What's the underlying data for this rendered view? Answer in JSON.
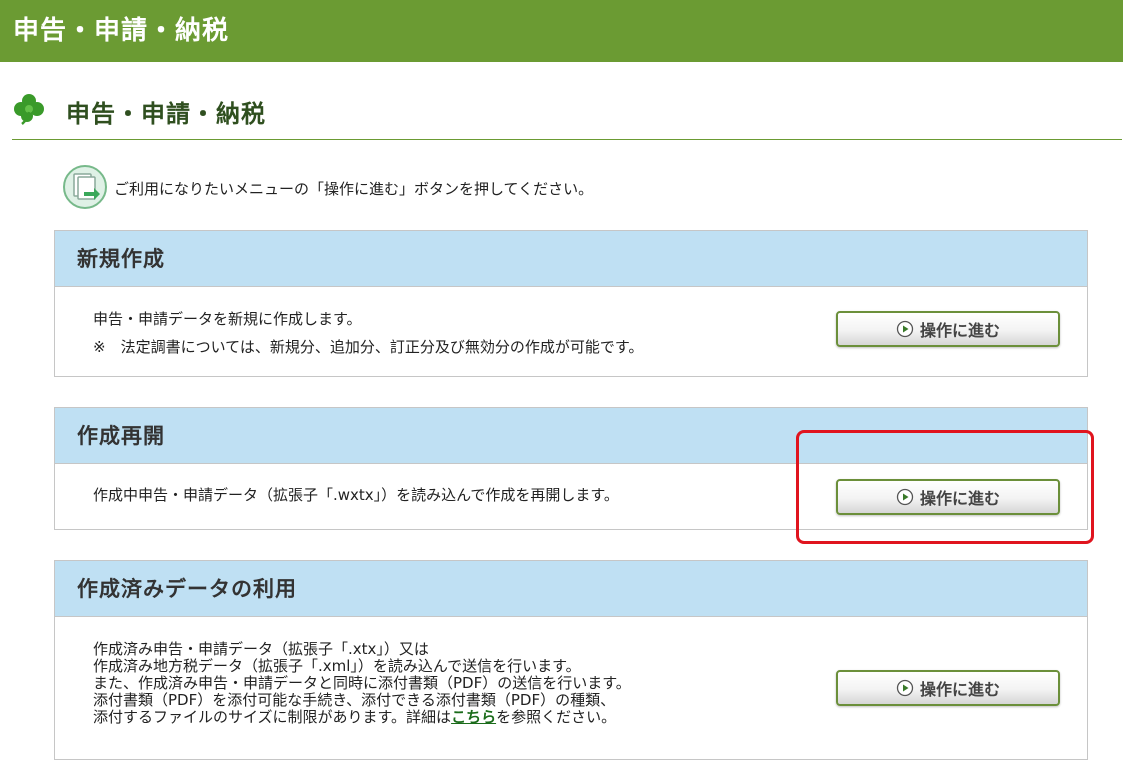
{
  "header": {
    "title": "申告・申請・納税"
  },
  "page": {
    "heading": "申告・申請・納税",
    "instruction": "ご利用になりたいメニューの「操作に進む」ボタンを押してください。"
  },
  "sections": [
    {
      "title": "新規作成",
      "lines": [
        "申告・申請データを新規に作成します。",
        "※　法定調書については、新規分、追加分、訂正分及び無効分の作成が可能です。"
      ],
      "button_label": "操作に進む"
    },
    {
      "title": "作成再開",
      "lines": [
        "作成中申告・申請データ（拡張子「.wxtx」）を読み込んで作成を再開します。"
      ],
      "button_label": "操作に進む"
    },
    {
      "title": "作成済みデータの利用",
      "lines": [
        "作成済み申告・申請データ（拡張子「.xtx」）又は",
        "作成済み地方税データ（拡張子「.xml」）を読み込んで送信を行います。",
        "また、作成済み申告・申請データと同時に添付書類（PDF）の送信を行います。",
        "添付書類（PDF）を添付可能な手続き、添付できる添付書類（PDF）の種類、"
      ],
      "last_line_prefix": "添付するファイルのサイズに制限があります。詳細は",
      "last_line_link": "こちら",
      "last_line_suffix": "を参照ください。",
      "button_label": "操作に進む"
    }
  ],
  "colors": {
    "header_bg": "#6b9b33",
    "section_header_bg": "#bfe0f3",
    "highlight": "#e0141e",
    "button_border": "#6b8f3a"
  }
}
